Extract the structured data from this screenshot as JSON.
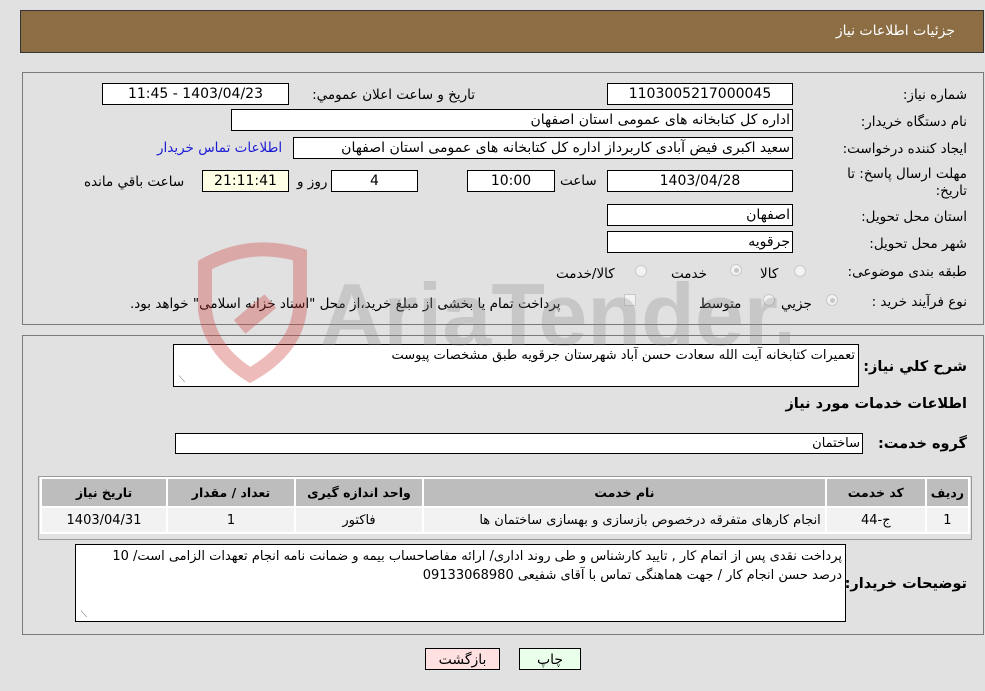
{
  "header": {
    "title": "جزئیات اطلاعات نیاز"
  },
  "form": {
    "need_number_label": "شماره نیاز:",
    "need_number": "1103005217000045",
    "announce_label": "تاريخ و ساعت اعلان عمومي:",
    "announce_value": "1403/04/23 - 11:45",
    "buyer_org_label": "نام دستگاه خریدار:",
    "buyer_org": "اداره کل کتابخانه های عمومی استان اصفهان",
    "requester_label": "ایجاد کننده درخواست:",
    "requester": "سعید اکبری فیض آبادی کاربرداز اداره کل کتابخانه های عمومی استان اصفهان",
    "contact_link": "اطلاعات تماس خریدار",
    "deadline_label_1": "مهلت ارسال پاسخ: تا",
    "deadline_label_2": "تاریخ:",
    "deadline_date": "1403/04/28",
    "time_label": "ساعت",
    "deadline_time": "10:00",
    "days_value": "4",
    "days_label": "روز و",
    "remaining_time": "21:11:41",
    "remaining_label": "ساعت باقي مانده",
    "province_label": "استان محل تحویل:",
    "province": "اصفهان",
    "city_label": "شهر محل تحویل:",
    "city": "جرقویه",
    "category_label": "طبقه بندی موضوعی:",
    "category_options": [
      {
        "label": "کالا",
        "checked": false
      },
      {
        "label": "خدمت",
        "checked": true
      },
      {
        "label": "کالا/خدمت",
        "checked": false
      }
    ],
    "process_label": "نوع فرآیند خرید :",
    "process_options": [
      {
        "label": "جزيي",
        "checked": true
      },
      {
        "label": "متوسط",
        "checked": false
      }
    ],
    "treasury_checkbox_label": "پرداخت تمام یا بخشی از مبلغ خرید،از محل \"اسناد خزانه اسلامی\" خواهد بود.",
    "treasury_checked": false
  },
  "details": {
    "summary_label": "شرح كلي نياز:",
    "summary": "تعمیرات کتابخانه آیت الله سعادت حسن آباد شهرستان جرقویه طبق مشخصات پیوست",
    "services_heading": "اطلاعات خدمات مورد نياز",
    "service_group_label": "گروه خدمت:",
    "service_group": "ساختمان",
    "table": {
      "headers": [
        "رديف",
        "كد خدمت",
        "نام خدمت",
        "واحد اندازه گيری",
        "تعداد / مقدار",
        "تاريخ نياز"
      ],
      "rows": [
        [
          "1",
          "ج-44",
          "انجام کارهای متفرقه درخصوص بازسازی و بهسازی ساختمان ها",
          "فاکتور",
          "1",
          "1403/04/31"
        ]
      ]
    },
    "buyer_notes_label": "توضيحات خريدار:",
    "buyer_notes": "پرداخت نقدی پس از اتمام کار , تایید کارشناس و طی روند اداری/ ارائه مفاصاحساب بیمه و ضمانت نامه انجام تعهدات الزامی است/ 10 درصد حسن انجام کار / جهت هماهنگی تماس با آقای شفیعی 09133068980"
  },
  "buttons": {
    "print": "چاپ",
    "back": "بازگشت"
  },
  "colors": {
    "header_bg": "#8c6d44",
    "print_bg": "#eaffea",
    "back_bg": "#ffe1e1",
    "link": "#1a1ad6"
  },
  "watermark": {
    "text": "AriaTender.net"
  }
}
